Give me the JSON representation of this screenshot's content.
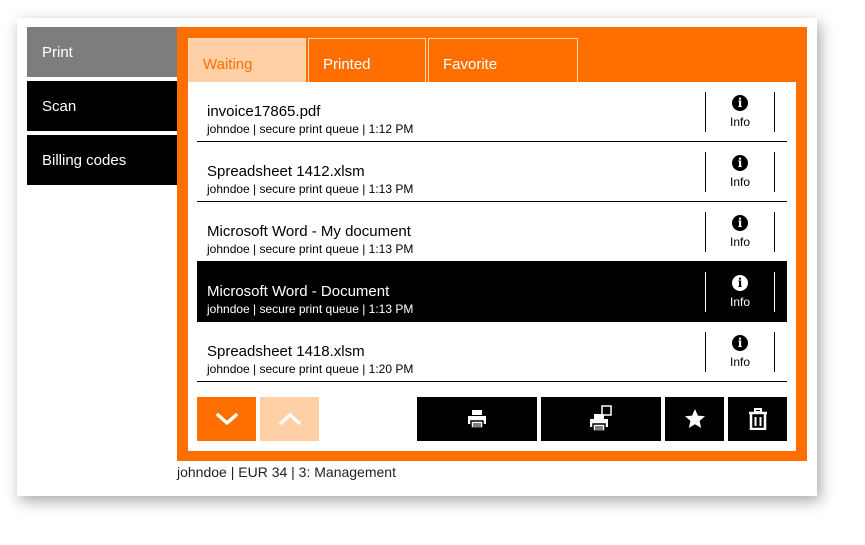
{
  "sidebar": {
    "items": [
      {
        "label": "Print"
      },
      {
        "label": "Scan"
      },
      {
        "label": "Billing codes"
      }
    ]
  },
  "tabs": [
    {
      "label": "Waiting"
    },
    {
      "label": "Printed"
    },
    {
      "label": "Favorite"
    }
  ],
  "jobs": [
    {
      "title": "invoice17865.pdf",
      "subtitle": "johndoe | secure print queue | 1:12 PM",
      "info_label": "Info"
    },
    {
      "title": "Spreadsheet 1412.xlsm",
      "subtitle": "johndoe | secure print queue | 1:13 PM",
      "info_label": "Info"
    },
    {
      "title": "Microsoft Word - My document",
      "subtitle": "johndoe | secure print queue | 1:13 PM",
      "info_label": "Info"
    },
    {
      "title": "Microsoft Word - Document",
      "subtitle": "johndoe | secure print queue | 1:13 PM",
      "info_label": "Info"
    },
    {
      "title": "Spreadsheet 1418.xlsm",
      "subtitle": "johndoe | secure print queue | 1:20 PM",
      "info_label": "Info"
    }
  ],
  "icons": {
    "info": "i",
    "scroll_down": "chevron-down-icon",
    "scroll_up": "chevron-up-icon",
    "print": "printer-icon",
    "print_copy": "print-copies-icon",
    "favorite": "star-icon",
    "delete": "trash-icon"
  },
  "colors": {
    "accent": "#ff6f00",
    "accent_light": "#ffcfa6",
    "sidebar_active": "#7d7d7d",
    "sidebar": "#000000",
    "selected_row": "#000000"
  },
  "status": "johndoe | EUR 34 | 3: Management"
}
